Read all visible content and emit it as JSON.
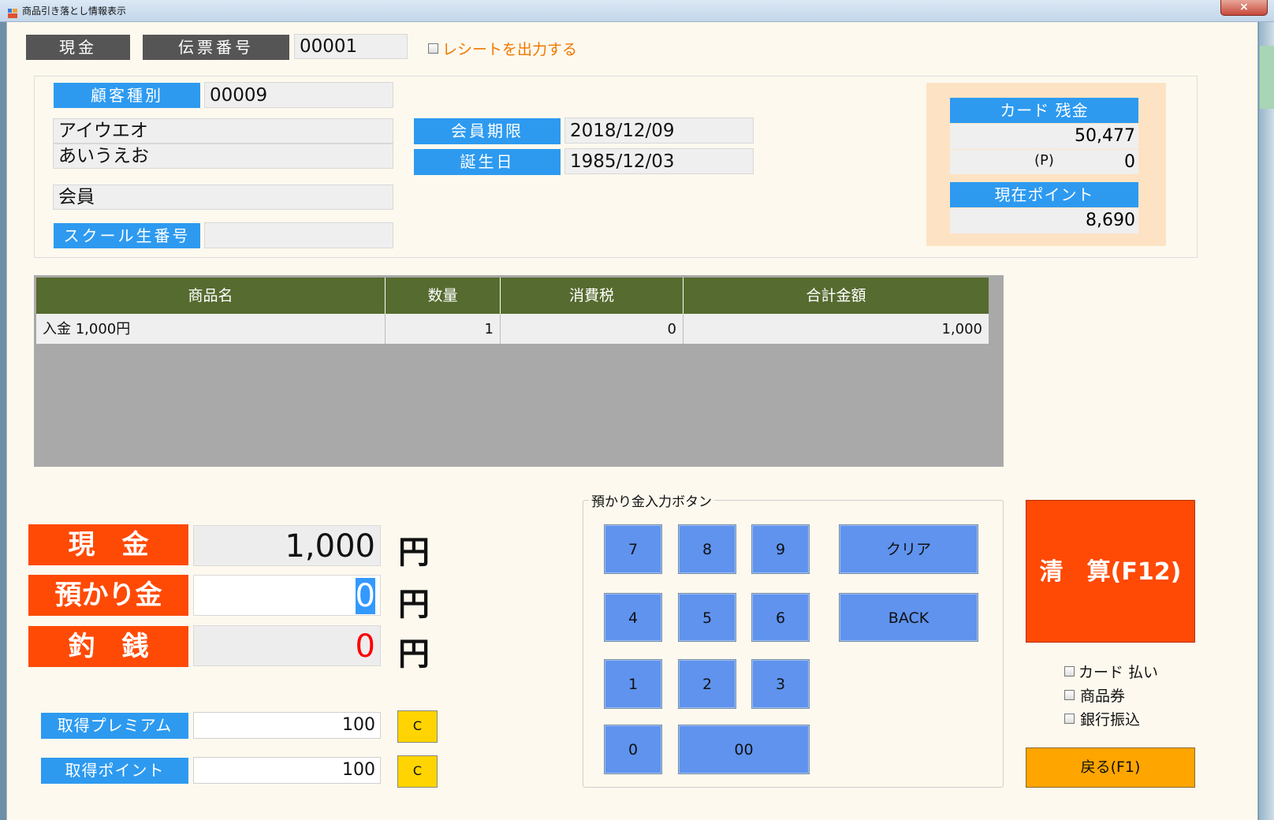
{
  "window": {
    "title": "商品引き落とし情報表示",
    "close": "×"
  },
  "header": {
    "payment_type": "現金",
    "slip_label": "伝票番号",
    "slip_number": "00001",
    "receipt_label": "レシートを出力する"
  },
  "customer": {
    "type_label": "顧客種別",
    "type_value": "00009",
    "kana_name": "アイウエオ",
    "name": "あいうえお",
    "category": "会員",
    "school_label": "スクール生番号",
    "school_value": "",
    "expiry_label": "会員期限",
    "expiry_value": "2018/12/09",
    "birthday_label": "誕生日",
    "birthday_value": "1985/12/03"
  },
  "card": {
    "balance_label": "カード 残金",
    "balance_value": "50,477",
    "p_label": "(P)",
    "p_value": "0",
    "points_label": "現在ポイント",
    "points_value": "8,690"
  },
  "grid": {
    "columns": [
      "商品名",
      "数量",
      "消費税",
      "合計金額"
    ],
    "rows": [
      {
        "name": "入金 1,000円",
        "qty": "1",
        "tax": "0",
        "total": "1,000"
      }
    ]
  },
  "amounts": {
    "cash_label": "現　金",
    "cash_value": "1,000",
    "deposit_label": "預かり金",
    "deposit_value": "0",
    "change_label": "釣　銭",
    "change_value": "0",
    "yen": "円",
    "premium_label": "取得プレミアム",
    "premium_value": "100",
    "points_label": "取得ポイント",
    "points_value": "100",
    "clear_c": "C"
  },
  "keypad": {
    "title": "預かり金入力ボタン",
    "keys": [
      "7",
      "8",
      "9",
      "4",
      "5",
      "6",
      "1",
      "2",
      "3",
      "0",
      "00"
    ],
    "clear": "クリア",
    "back": "BACK"
  },
  "actions": {
    "settle": "清　算(F12)",
    "card_pay": "カード 払い",
    "gift_cert": "商品券",
    "bank_transfer": "銀行振込",
    "back": "戻る(F1)"
  },
  "colors": {
    "accent_red": "#ff4a05",
    "label_blue": "#2d9af0",
    "grid_header": "#566b2f",
    "key_blue": "#5f93ee",
    "back_orange": "#ffa500",
    "change_red": "#ff0000"
  }
}
